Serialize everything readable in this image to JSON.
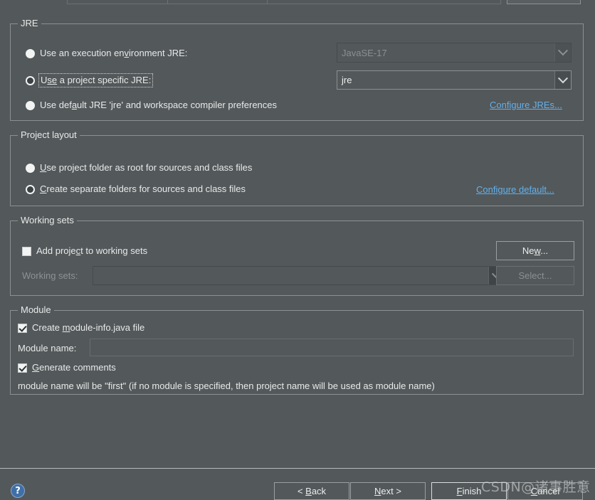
{
  "window": {
    "background_color": "#53585a",
    "link_color": "#63b0ec",
    "text_color": "#e8eaea",
    "disabled_text_color": "#8d9294"
  },
  "jre_group": {
    "legend": "JRE",
    "options": [
      {
        "label_before": "Use an execution en",
        "mnemonic": "v",
        "label_after": "ironment JRE:",
        "checked": false,
        "focused": false
      },
      {
        "label_before": "U",
        "mnemonic": "se",
        "label_after": " a project specific JRE:",
        "checked": true,
        "focused": true
      },
      {
        "label_before": "Use def",
        "mnemonic": "a",
        "label_after": "ult JRE 'jre' and workspace compiler preferences",
        "checked": false,
        "focused": false
      }
    ],
    "execution_env_combo": {
      "value": "JavaSE-17",
      "enabled": false,
      "arrow_icon": "chevron-down-icon"
    },
    "project_jre_combo": {
      "value": "jre",
      "enabled": true,
      "arrow_icon": "chevron-down-icon"
    },
    "configure_link": "Configure JREs..."
  },
  "layout_group": {
    "legend": "Project layout",
    "options": [
      {
        "label_before": "",
        "mnemonic": "U",
        "label_after": "se project folder as root for sources and class files",
        "checked": false
      },
      {
        "label_before": "",
        "mnemonic": "C",
        "label_after": "reate separate folders for sources and class files",
        "checked": true
      }
    ],
    "configure_link": "Configure default..."
  },
  "working_sets_group": {
    "legend": "Working sets",
    "add_checkbox": {
      "label_before": "Add proje",
      "mnemonic": "c",
      "label_after": "t to working sets",
      "checked": false
    },
    "working_sets_label": "Working sets:",
    "working_sets_combo": {
      "value": "",
      "enabled": false,
      "arrow_icon": "chevron-down-icon"
    },
    "new_button": {
      "label_before": "Ne",
      "mnemonic": "w",
      "label_after": "...",
      "enabled": true
    },
    "select_button": {
      "label": "Select...",
      "enabled": false
    }
  },
  "module_group": {
    "legend": "Module",
    "create_module_info": {
      "label_before": "Create ",
      "mnemonic": "m",
      "label_after": "odule-info.java file",
      "checked": true
    },
    "module_name_label": "Module name:",
    "module_name_input": {
      "value": "",
      "placeholder": ""
    },
    "generate_comments": {
      "label_before": "",
      "mnemonic": "G",
      "label_after": "enerate comments",
      "checked": true
    },
    "description": "module name will be \"first\"  (if no module is specified, then project name will be used as module name)"
  },
  "button_bar": {
    "help_icon": "?",
    "back": {
      "label_before": "< ",
      "mnemonic": "B",
      "label_after": "ack",
      "enabled": true,
      "focused": false
    },
    "next": {
      "label_before": "",
      "mnemonic": "N",
      "label_after": "ext >",
      "enabled": true,
      "focused": false
    },
    "finish": {
      "label_before": "",
      "mnemonic": "F",
      "label_after": "inish",
      "enabled": true,
      "focused": true
    },
    "cancel": {
      "label_before": "",
      "mnemonic": "C",
      "label_after": "ancel",
      "enabled": true,
      "focused": false
    }
  },
  "watermark": {
    "text": "CSDN@诸事胜意"
  }
}
